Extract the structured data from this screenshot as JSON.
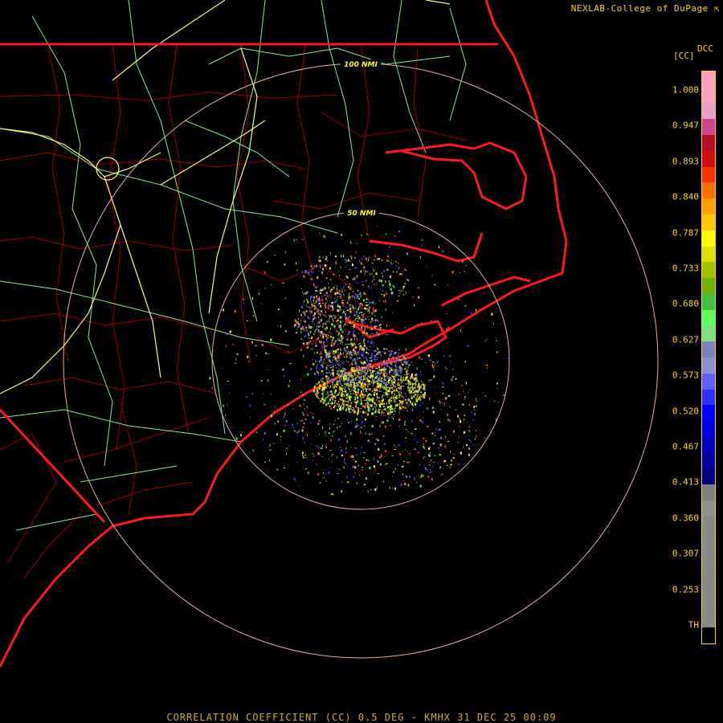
{
  "credit": "NEXLAB-College of DuPage",
  "credit_icon": "arrow-cursor-icon",
  "footer": "CORRELATION COEFFICIENT (CC) 0.5 DEG - KMHX 31 DEC 25 00:09",
  "legend": {
    "unit": "[CC]",
    "code": "DCC",
    "labels": [
      "1.000",
      "0.947",
      "0.893",
      "0.840",
      "0.787",
      "0.733",
      "0.680",
      "0.627",
      "0.573",
      "0.520",
      "0.467",
      "0.413",
      "0.360",
      "0.307",
      "0.253",
      "TH"
    ],
    "colors": [
      "#ff9fc0",
      "#ff9fc0",
      "#e8a0c8",
      "#d0458a",
      "#b01020",
      "#d01010",
      "#ff3000",
      "#ff7000",
      "#ffa000",
      "#ffc800",
      "#ffff00",
      "#e0e000",
      "#a0c000",
      "#70b000",
      "#40c040",
      "#60ff60",
      "#80e080",
      "#8080c0",
      "#9090d0",
      "#6060ff",
      "#3030ff",
      "#0000ff",
      "#0000e0",
      "#0000c0",
      "#0000a0",
      "#000080",
      "#808080",
      "#909090",
      "#888888",
      "#888888",
      "#888888",
      "#888888",
      "#888888",
      "#888888",
      "#888888",
      "#000000"
    ]
  },
  "rings": {
    "inner_label": "50 NMI",
    "outer_label": "100 NMI"
  },
  "colors": {
    "state_border": "#ff1a1a",
    "county_line": "#b00000",
    "highway_primary": "#ffff55",
    "highway_secondary": "#88ee88",
    "range_ring": "#e8b0a0",
    "legend_text": "#ffd700"
  }
}
